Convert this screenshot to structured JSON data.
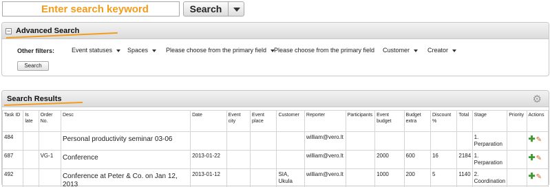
{
  "search": {
    "placeholder": "Enter search keyword",
    "button_label": "Search"
  },
  "advanced": {
    "title": "Advanced Search",
    "filters_label": "Other filters:",
    "filters": [
      "Event statuses",
      "Spaces",
      "Please choose from the primary field",
      "Please choose from the primary field",
      "Customer",
      "Creator"
    ],
    "search_button": "Search"
  },
  "results": {
    "title": "Search Results",
    "columns": [
      "Task ID",
      "Is late",
      "Order No.",
      "Desc",
      "Date",
      "Event city",
      "Event place",
      "Customer",
      "Reporter",
      "Participants",
      "Event budget",
      "Budget extra",
      "Discount %",
      "Total",
      "Stage",
      "Priority",
      "Actions"
    ],
    "rows": [
      {
        "task_id": "484",
        "is_late": "",
        "order_no": "",
        "desc": "Personal productivity seminar 03-06",
        "date": "",
        "event_city": "",
        "event_place": "",
        "customer": "",
        "reporter": "william@vero.lt",
        "participants": "",
        "event_budget": "",
        "budget_extra": "",
        "discount": "",
        "total": "",
        "stage": "1. Perparation",
        "priority": ""
      },
      {
        "task_id": "687",
        "is_late": "",
        "order_no": "VG-1",
        "desc": "Conference",
        "date": "2013-01-22",
        "event_city": "",
        "event_place": "",
        "customer": "",
        "reporter": "william@vero.lt",
        "participants": "",
        "event_budget": "2000",
        "budget_extra": "600",
        "discount": "16",
        "total": "2184",
        "stage": "1. Perparation",
        "priority": ""
      },
      {
        "task_id": "492",
        "is_late": "",
        "order_no": "",
        "desc": "Conference at Peter & Co. on Jan 12, 2013",
        "date": "2013-01-12",
        "event_city": "",
        "event_place": "",
        "customer": "SIA, Ukula",
        "reporter": "william@vero.lt",
        "participants": "",
        "event_budget": "1000",
        "budget_extra": "200",
        "discount": "5",
        "total": "1140",
        "stage": "2. Coordination",
        "priority": ""
      }
    ]
  },
  "colors": {
    "accent": "#f39c1b",
    "add_icon": "#3b9a2e",
    "edit_icon": "#d35f18"
  },
  "icons": [
    "collapse-icon",
    "chevron-down-icon",
    "gear-icon",
    "add-icon",
    "edit-icon"
  ]
}
